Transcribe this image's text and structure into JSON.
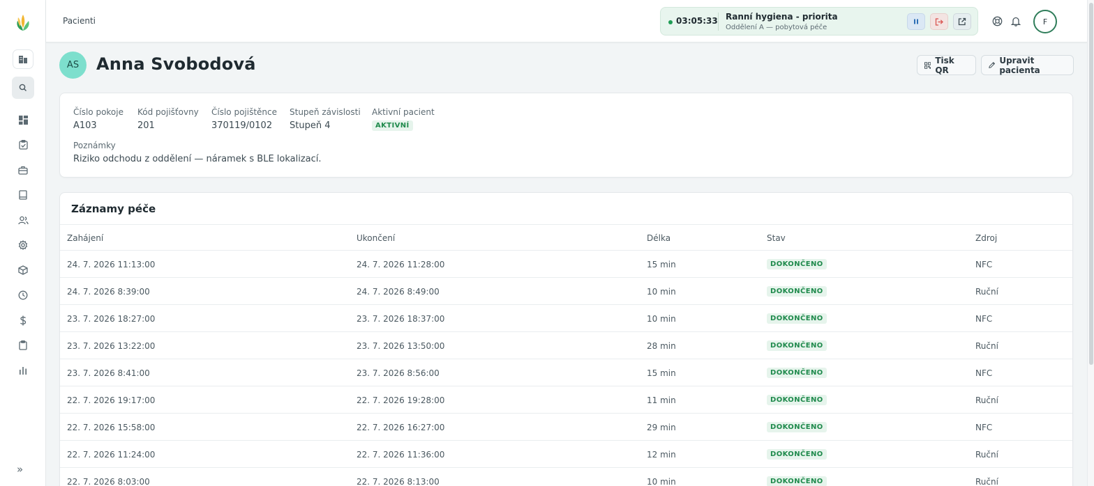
{
  "app": {
    "brand_color": "#1f9d55"
  },
  "header": {
    "breadcrumb": "Pacienti"
  },
  "timer": {
    "elapsed": "03:05:33",
    "task": "Ranní hygiena - priorita",
    "location": "Oddělení A — pobytová péče"
  },
  "user": {
    "initial": "F"
  },
  "patient": {
    "initials": "AS",
    "name": "Anna Svobodová",
    "print_qr_label": "Tisk QR",
    "edit_label": "Upravit pacienta",
    "fields": [
      {
        "label": "Číslo pokoje",
        "value": "A103"
      },
      {
        "label": "Kód pojišťovny",
        "value": "201"
      },
      {
        "label": "Číslo pojištěnce",
        "value": "370119/0102"
      },
      {
        "label": "Stupeň závislosti",
        "value": "Stupeň 4"
      },
      {
        "label": "Aktivní pacient",
        "value": "AKTIVNÍ"
      }
    ],
    "notes_label": "Poznámky",
    "notes": "Riziko odchodu z oddělení — náramek s BLE lokalizací."
  },
  "records": {
    "title": "Záznamy péče",
    "columns": [
      "Zahájení",
      "Ukončení",
      "Délka",
      "Stav",
      "Zdroj"
    ],
    "rows": [
      [
        "24. 7. 2026 11:13:00",
        "24. 7. 2026 11:28:00",
        "15 min",
        "DOKONČENO",
        "NFC"
      ],
      [
        "24. 7. 2026 8:39:00",
        "24. 7. 2026 8:49:00",
        "10 min",
        "DOKONČENO",
        "Ruční"
      ],
      [
        "23. 7. 2026 18:27:00",
        "23. 7. 2026 18:37:00",
        "10 min",
        "DOKONČENO",
        "NFC"
      ],
      [
        "23. 7. 2026 13:22:00",
        "23. 7. 2026 13:50:00",
        "28 min",
        "DOKONČENO",
        "Ruční"
      ],
      [
        "23. 7. 2026 8:41:00",
        "23. 7. 2026 8:56:00",
        "15 min",
        "DOKONČENO",
        "NFC"
      ],
      [
        "22. 7. 2026 19:17:00",
        "22. 7. 2026 19:28:00",
        "11 min",
        "DOKONČENO",
        "Ruční"
      ],
      [
        "22. 7. 2026 15:58:00",
        "22. 7. 2026 16:27:00",
        "29 min",
        "DOKONČENO",
        "NFC"
      ],
      [
        "22. 7. 2026 11:24:00",
        "22. 7. 2026 11:36:00",
        "12 min",
        "DOKONČENO",
        "Ruční"
      ],
      [
        "22. 7. 2026 8:03:00",
        "22. 7. 2026 8:13:00",
        "10 min",
        "DOKONČENO",
        "Ruční"
      ]
    ]
  },
  "sidebar": {
    "expand_glyph": "»",
    "icons": [
      "buildings-icon",
      "search-icon",
      "dashboard-icon",
      "clipboard-check-icon",
      "briefcase-icon",
      "book-icon",
      "users-icon",
      "gear-icon",
      "box-icon",
      "clock-icon",
      "dollar-icon",
      "clipboard-icon",
      "bar-chart-icon"
    ]
  }
}
